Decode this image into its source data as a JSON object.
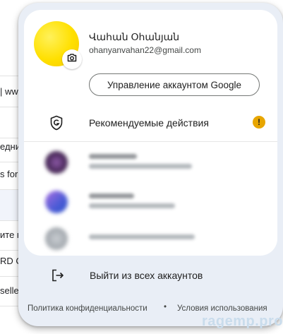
{
  "background": {
    "rows": [
      "",
      "| www",
      "",
      "едни",
      "s for",
      "",
      "ите н",
      "RD C",
      "selle",
      ""
    ]
  },
  "account": {
    "name": "Վահան Օհանյան",
    "email": "ohanyanvahan22@gmail.com",
    "avatar_color": "#ffe000",
    "camera_icon": "camera-icon"
  },
  "manage_button": {
    "label": "Управление аккаунтом Google"
  },
  "recommended": {
    "label": "Рекомендуемые действия",
    "icon": "shield-google-icon",
    "badge": "!",
    "badge_color": "#e8a600"
  },
  "other_accounts_colors": [
    "#5b2a6e",
    "#4b5bd6",
    "#9aa0a6"
  ],
  "logout": {
    "label": "Выйти из всех аккаунтов",
    "icon": "logout-icon"
  },
  "footer": {
    "privacy": "Политика конфиденциальности",
    "separator": "•",
    "terms": "Условия использования"
  },
  "watermark": "ragemp.pro"
}
